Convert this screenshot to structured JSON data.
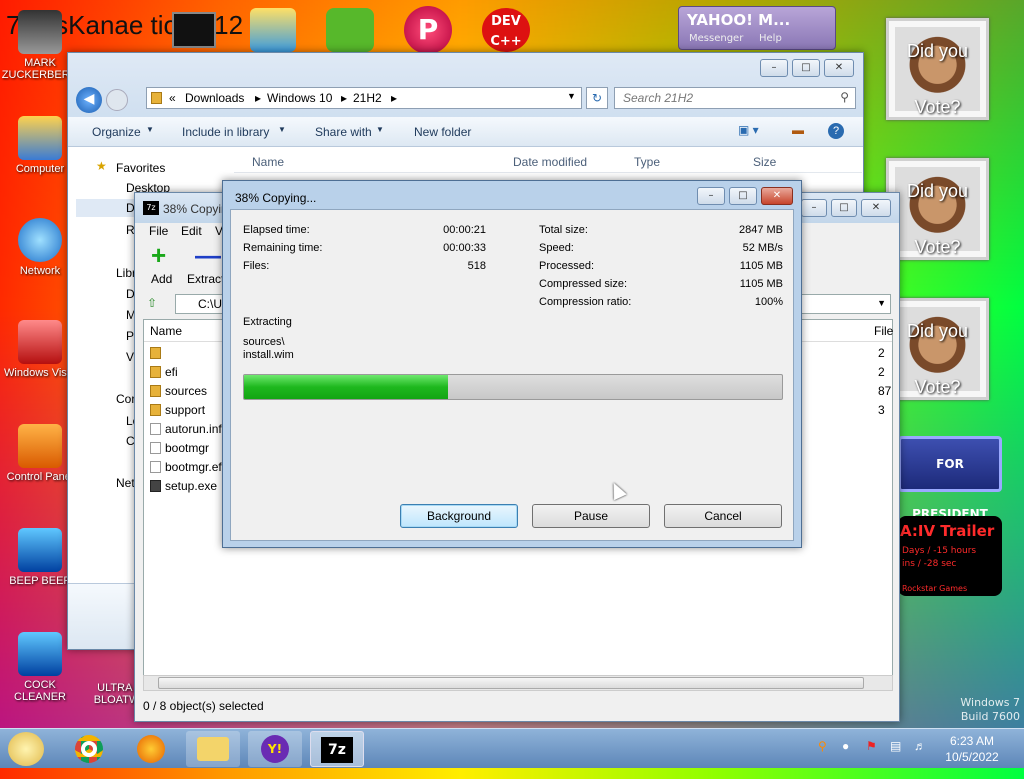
{
  "desktop": {
    "top_text": "7 ossKanae tion 012",
    "icons": [
      {
        "label": "MARK ZUCKERBERG"
      },
      {
        "label": "Computer"
      },
      {
        "label": "Network"
      },
      {
        "label": "Windows Vista"
      },
      {
        "label": "Control Panel"
      },
      {
        "label": "BEEP BEEP"
      },
      {
        "label": "COCK CLEANER"
      },
      {
        "label": "ULTRA C BLOATWA"
      }
    ],
    "gadgets": [
      {
        "line1": "Did you",
        "line2": "Vote?"
      },
      {
        "line1": "Did you",
        "line2": "Vote?"
      },
      {
        "line1": "Did you",
        "line2": "Vote?"
      }
    ],
    "banner": "FOR PRESIDENT",
    "gta": {
      "title": "A:IV Trailer",
      "line1": "Days / -15 hours",
      "line2": "ins / -28 sec",
      "line3": "Rockstar Games"
    },
    "watermark1": "Windows 7",
    "watermark2": "Build 7600",
    "yahoo": {
      "title": "YAHOO! M...",
      "sub1": "Messenger",
      "sub2": "Help"
    }
  },
  "explorer": {
    "breadcrumb": [
      "Downloads",
      "Windows 10",
      "21H2"
    ],
    "search_placeholder": "Search 21H2",
    "toolbar": [
      "Organize",
      "Include in library",
      "Share with",
      "New folder"
    ],
    "nav": {
      "favorites": "Favorites",
      "desktop": "Desktop",
      "item_d": "D",
      "item_r": "R",
      "libraries": "Libr",
      "lib_items": [
        "D",
        "M",
        "P",
        "V"
      ],
      "computer": "Cor",
      "comp_items": [
        "Lo",
        "C"
      ],
      "network": "Net"
    },
    "columns": [
      "Name",
      "Date modified",
      "Type",
      "Size"
    ]
  },
  "sevenzip": {
    "title": "38% Copying...",
    "menu": [
      "File",
      "Edit",
      "V"
    ],
    "add_label": "Add",
    "extract_label": "Extract",
    "path": "C:\\U",
    "col_name": "Name",
    "col_size": "File",
    "files": [
      {
        "name": "",
        "icon": "folder",
        "size": "2"
      },
      {
        "name": "efi",
        "icon": "folder",
        "size": "2"
      },
      {
        "name": "sources",
        "icon": "folder",
        "size": "87"
      },
      {
        "name": "support",
        "icon": "folder",
        "size": "3"
      },
      {
        "name": "autorun.inf",
        "icon": "file",
        "size": ""
      },
      {
        "name": "bootmgr",
        "icon": "file",
        "size": ""
      },
      {
        "name": "bootmgr.efi",
        "icon": "file",
        "size": ""
      },
      {
        "name": "setup.exe",
        "icon": "exe",
        "size": ""
      }
    ],
    "status": "0 / 8 object(s) selected"
  },
  "progress": {
    "title": "38% Copying...",
    "left": [
      {
        "label": "Elapsed time:",
        "value": "00:00:21"
      },
      {
        "label": "Remaining time:",
        "value": "00:00:33"
      },
      {
        "label": "Files:",
        "value": "518"
      }
    ],
    "right": [
      {
        "label": "Total size:",
        "value": "2847 MB"
      },
      {
        "label": "Speed:",
        "value": "52 MB/s"
      },
      {
        "label": "Processed:",
        "value": "1105 MB"
      },
      {
        "label": "Compressed size:",
        "value": "1105 MB"
      },
      {
        "label": "Compression ratio:",
        "value": "100%"
      }
    ],
    "action": "Extracting",
    "path1": "sources\\",
    "path2": "install.wim",
    "percent": 38,
    "buttons": {
      "background": "Background",
      "pause": "Pause",
      "cancel": "Cancel"
    }
  },
  "taskbar": {
    "time": "6:23 AM",
    "date": "10/5/2022"
  },
  "colors": {
    "progress": "#2fc62f",
    "accent": "#3c7fb1"
  }
}
